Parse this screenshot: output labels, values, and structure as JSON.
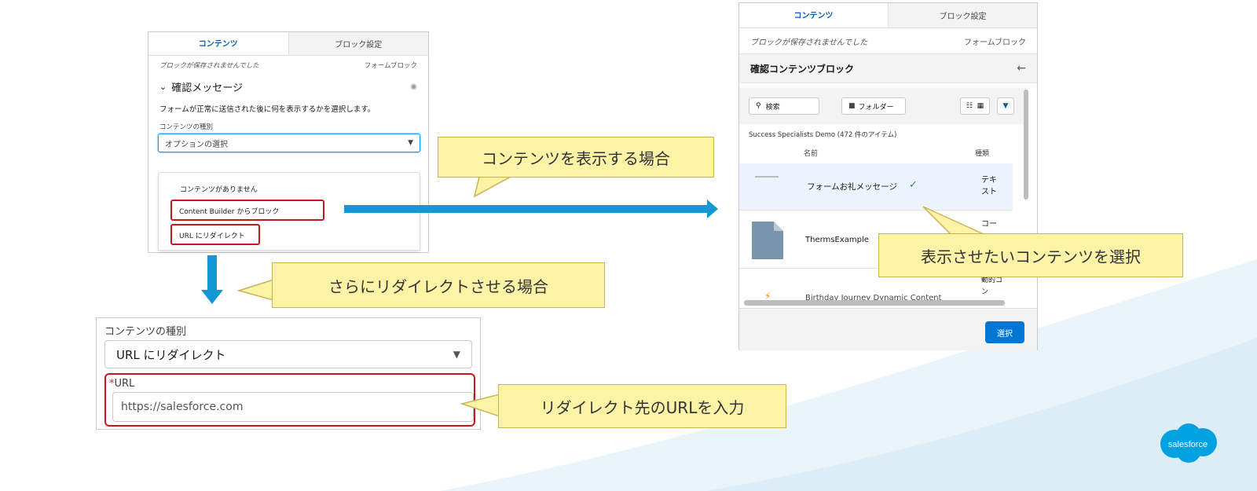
{
  "left_panel": {
    "tabs": [
      "コンテンツ",
      "ブロック設定"
    ],
    "status": "ブロックが保存されませんでした",
    "block_type": "フォームブロック",
    "section_title": "確認メッセージ",
    "description": "フォームが正常に送信された後に何を表示するかを選択します。",
    "content_type_label": "コンテンツの種別",
    "select_placeholder": "オプションの選択",
    "options": [
      "コンテンツがありません",
      "Content Builder からブロック",
      "URL にリダイレクト"
    ]
  },
  "bottom_panel": {
    "content_type_label": "コンテンツの種別",
    "selected_value": "URL にリダイレクト",
    "required_mark": "*",
    "url_label": "URL",
    "url_value": "https://salesforce.com"
  },
  "right_panel": {
    "tabs": [
      "コンテンツ",
      "ブロック設定"
    ],
    "status": "ブロックが保存されませんでした",
    "block_type": "フォームブロック",
    "header_title": "確認コンテンツブロック",
    "search_label": "検索",
    "folder_label": "フォルダー",
    "meta": "Success Specialists Demo (472 件のアイテム)",
    "columns": {
      "name": "名前",
      "type": "種類"
    },
    "rows": [
      {
        "name": "フォームお礼メッセージ",
        "type": "テキスト",
        "selected": true
      },
      {
        "name": "ThermsExample",
        "type": "コー"
      },
      {
        "name": "Birthday Journey Dynamic Content",
        "type": "動的コン"
      }
    ],
    "select_button": "選択"
  },
  "callouts": {
    "show_content": "コンテンツを表示する場合",
    "redirect": "さらにリダイレクトさせる場合",
    "choose_content": "表示させたいコンテンツを選択",
    "enter_url": "リダイレクト先のURLを入力"
  },
  "logo_text": "salesforce",
  "colors": {
    "arrow": "#1498d5",
    "highlight": "#c8181e",
    "callout_fill": "#fdf3a7",
    "primary_button": "#0176d3",
    "brand_blue": "#00a1e0"
  }
}
